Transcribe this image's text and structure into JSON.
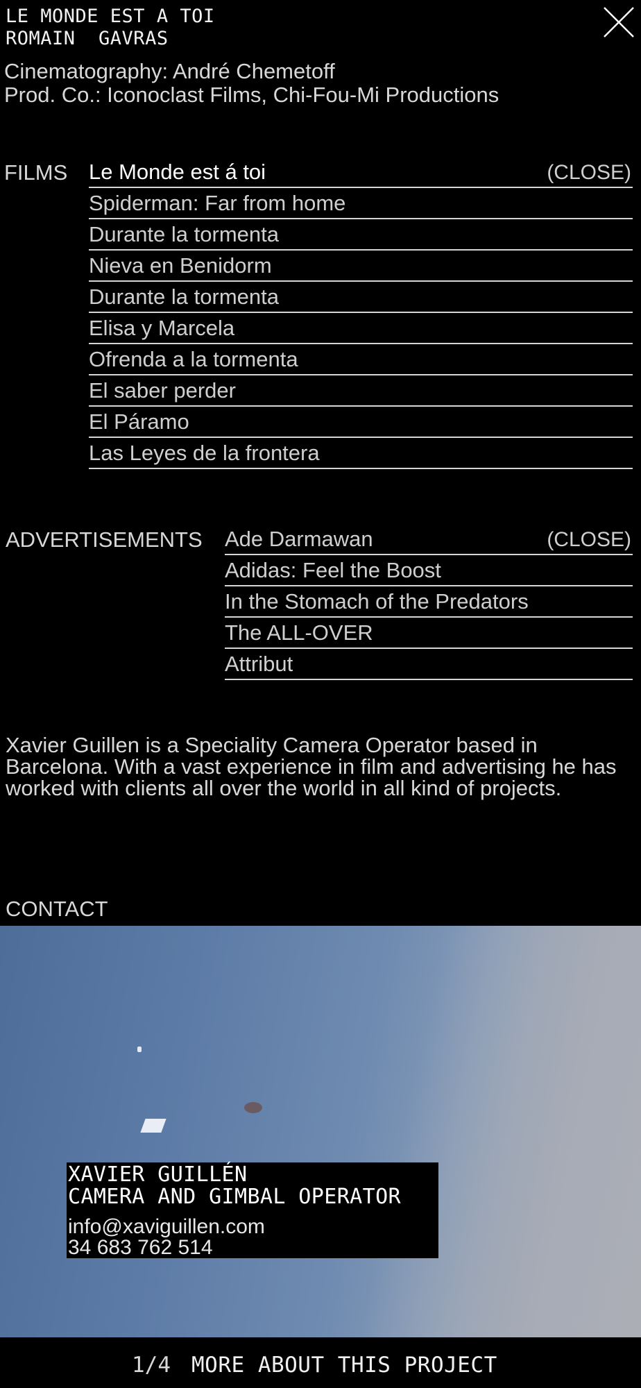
{
  "project": {
    "title_line1": "LE MONDE EST A TOI",
    "title_line2": "ROMAIN  GAVRAS",
    "credit_cinematography": "Cinematography: André Chemetoff",
    "credit_production": "Prod. Co.: Iconoclast Films, Chi-Fou-Mi Productions"
  },
  "films": {
    "label": "FILMS",
    "close_label": "(CLOSE)",
    "items": [
      {
        "label": "Le Monde est á toi",
        "active": true
      },
      {
        "label": "Spiderman: Far from home"
      },
      {
        "label": "Durante la tormenta"
      },
      {
        "label": "Nieva en Benidorm"
      },
      {
        "label": "Durante la tormenta"
      },
      {
        "label": "Elisa y Marcela"
      },
      {
        "label": "Ofrenda a la tormenta"
      },
      {
        "label": "El saber perder"
      },
      {
        "label": "El Páramo"
      },
      {
        "label": "Las Leyes de la frontera"
      }
    ]
  },
  "advertisements": {
    "label": "ADVERTISEMENTS",
    "close_label": "(CLOSE)",
    "items": [
      {
        "label": "Ade Darmawan"
      },
      {
        "label": "Adidas: Feel the Boost"
      },
      {
        "label": "In the Stomach of the Predators"
      },
      {
        "label": "The ALL-OVER"
      },
      {
        "label": "Attribut"
      }
    ]
  },
  "bio": "Xavier Guillen is a Speciality Camera Operator based in Barcelona. With a vast experience in film and advertising he has worked with clients all over the world in all kind of projects.",
  "contact_label": "CONTACT",
  "card": {
    "name": "XAVIER GUILLÉN",
    "role": "CAMERA AND GIMBAL OPERATOR",
    "email": "info@xaviguillen.com",
    "phone": "34 683 762 514"
  },
  "footer": {
    "counter": "1/4",
    "more_label": "MORE ABOUT THIS PROJECT"
  },
  "icons": {
    "close": "close-icon"
  }
}
